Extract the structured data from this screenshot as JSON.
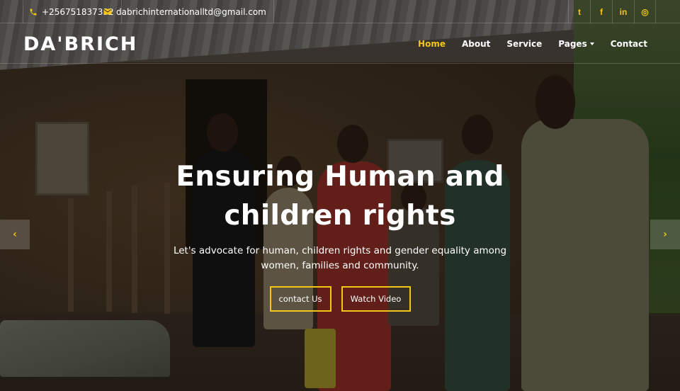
{
  "topbar": {
    "phone": "+256751837332",
    "email": "dabrichinternationalltd@gmail.com",
    "phone_icon": "phone-icon",
    "email_icon": "envelope-icon",
    "socials": [
      {
        "icon": "twitter-icon",
        "glyph": "t"
      },
      {
        "icon": "facebook-icon",
        "glyph": "f"
      },
      {
        "icon": "linkedin-icon",
        "glyph": "in"
      },
      {
        "icon": "instagram-icon",
        "glyph": "◎"
      }
    ]
  },
  "brand": {
    "logo": "DA'BRICH"
  },
  "nav": {
    "items": [
      {
        "label": "Home",
        "active": true
      },
      {
        "label": "About",
        "active": false
      },
      {
        "label": "Service",
        "active": false
      },
      {
        "label": "Pages",
        "active": false,
        "dropdown": true
      },
      {
        "label": "Contact",
        "active": false
      }
    ]
  },
  "hero": {
    "title_line1": "Ensuring Human and",
    "title_line2": "children rights",
    "subtitle_line1": "Let's advocate for human, children rights and gender equality among",
    "subtitle_line2": "women, families and community.",
    "primary_button": "contact Us",
    "secondary_button": "Watch Video"
  },
  "carousel": {
    "prev_icon": "chevron-left-icon",
    "next_icon": "chevron-right-icon",
    "prev_glyph": "‹",
    "next_glyph": "›"
  },
  "colors": {
    "accent": "#f5c518",
    "overlay": "rgba(0,0,0,0.45)"
  }
}
